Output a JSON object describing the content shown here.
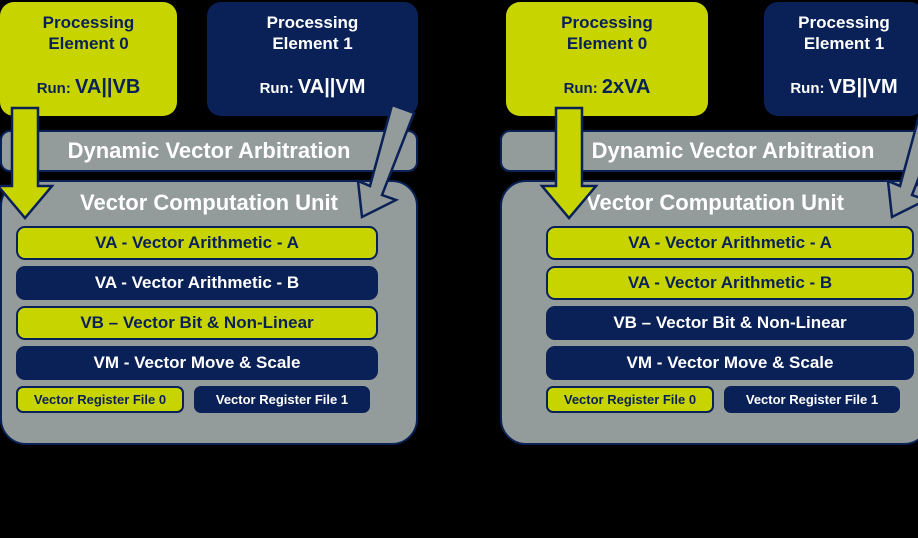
{
  "colors": {
    "background": "#000000",
    "highlight_yellow": "#c8d400",
    "navy": "#0a2158",
    "gray": "#939b9b",
    "white": "#ffffff"
  },
  "panels": [
    {
      "id": "left",
      "processing_elements": [
        {
          "name": "Processing\nElement 0",
          "run_prefix": "Run: ",
          "run_value": "VA||VB",
          "fill": "yellow"
        },
        {
          "name": "Processing\nElement 1",
          "run_prefix": "Run: ",
          "run_value": "VA||VM",
          "fill": "navy"
        }
      ],
      "arbitration_label": "Dynamic Vector Arbitration",
      "vcu_title": "Vector Computation Unit",
      "units": [
        {
          "label": "VA - Vector Arithmetic - A",
          "fill": "yellow"
        },
        {
          "label": "VA - Vector Arithmetic - B",
          "fill": "navy"
        },
        {
          "label": "VB – Vector Bit & Non-Linear",
          "fill": "yellow"
        },
        {
          "label": "VM - Vector Move & Scale",
          "fill": "navy"
        }
      ],
      "register_files": [
        {
          "label": "Vector Register File 0",
          "fill": "yellow"
        },
        {
          "label": "Vector Register File 1",
          "fill": "navy"
        }
      ],
      "arrows": [
        {
          "kind": "straight-down",
          "color": "yellow",
          "from": "processing-element-0"
        },
        {
          "kind": "slanted-down-left",
          "color": "gray",
          "from": "processing-element-1"
        }
      ]
    },
    {
      "id": "right",
      "processing_elements": [
        {
          "name": "Processing\nElement 0",
          "run_prefix": "Run: ",
          "run_value": "2xVA",
          "fill": "yellow"
        },
        {
          "name": "Processing\nElement 1",
          "run_prefix": "Run: ",
          "run_value": "VB||VM",
          "fill": "navy"
        }
      ],
      "arbitration_label": "Dynamic Vector Arbitration",
      "vcu_title": "Vector Computation Unit",
      "units": [
        {
          "label": "VA - Vector Arithmetic - A",
          "fill": "yellow"
        },
        {
          "label": "VA - Vector Arithmetic - B",
          "fill": "yellow"
        },
        {
          "label": "VB – Vector Bit & Non-Linear",
          "fill": "navy"
        },
        {
          "label": "VM - Vector Move & Scale",
          "fill": "navy"
        }
      ],
      "register_files": [
        {
          "label": "Vector Register File 0",
          "fill": "yellow"
        },
        {
          "label": "Vector Register File 1",
          "fill": "navy"
        }
      ],
      "arrows": [
        {
          "kind": "straight-down",
          "color": "yellow",
          "from": "processing-element-0"
        },
        {
          "kind": "slanted-down-left",
          "color": "gray",
          "from": "processing-element-1"
        }
      ]
    }
  ]
}
